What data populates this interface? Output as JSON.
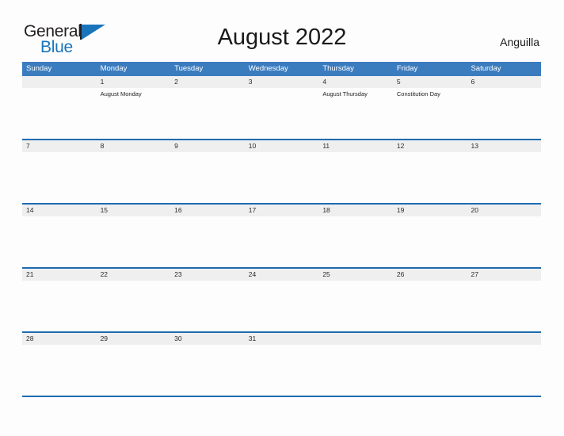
{
  "logo": {
    "word1": "General",
    "word2": "Blue",
    "accent_color": "#1a74bb",
    "triangle_icon": "triangle-icon"
  },
  "header": {
    "title": "August 2022",
    "country": "Anguilla"
  },
  "colors": {
    "header_blue": "#3b7cbf",
    "divider_blue": "#1f6bb0",
    "date_band_gray": "#efefef",
    "page_background": "#fdfdfd",
    "text_dark": "#1a1a1a"
  },
  "calendar": {
    "day_headers": [
      "Sunday",
      "Monday",
      "Tuesday",
      "Wednesday",
      "Thursday",
      "Friday",
      "Saturday"
    ],
    "weeks": [
      {
        "dates": [
          "",
          "1",
          "2",
          "3",
          "4",
          "5",
          "6"
        ],
        "events": [
          "",
          "August Monday",
          "",
          "",
          "August Thursday",
          "Constitution Day",
          ""
        ]
      },
      {
        "dates": [
          "7",
          "8",
          "9",
          "10",
          "11",
          "12",
          "13"
        ],
        "events": [
          "",
          "",
          "",
          "",
          "",
          "",
          ""
        ]
      },
      {
        "dates": [
          "14",
          "15",
          "16",
          "17",
          "18",
          "19",
          "20"
        ],
        "events": [
          "",
          "",
          "",
          "",
          "",
          "",
          ""
        ]
      },
      {
        "dates": [
          "21",
          "22",
          "23",
          "24",
          "25",
          "26",
          "27"
        ],
        "events": [
          "",
          "",
          "",
          "",
          "",
          "",
          ""
        ]
      },
      {
        "dates": [
          "28",
          "29",
          "30",
          "31",
          "",
          "",
          ""
        ],
        "events": [
          "",
          "",
          "",
          "",
          "",
          "",
          ""
        ]
      }
    ]
  }
}
